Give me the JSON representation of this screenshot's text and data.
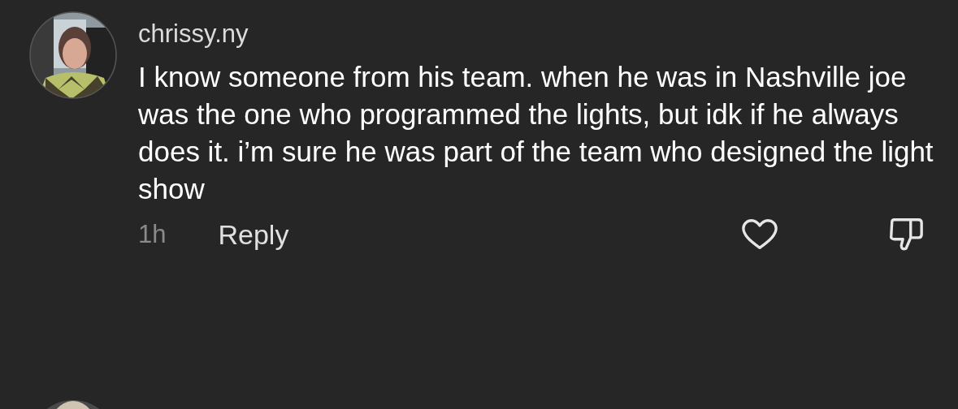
{
  "comment": {
    "username": "chrissy.ny",
    "text": "I know someone from his team. when he was in Nashville joe was the one who programmed the lights, but idk if he always does it. i’m sure he was part of the team who designed the light show",
    "time": "1h",
    "reply": "Reply",
    "liked": false,
    "disliked": false
  }
}
